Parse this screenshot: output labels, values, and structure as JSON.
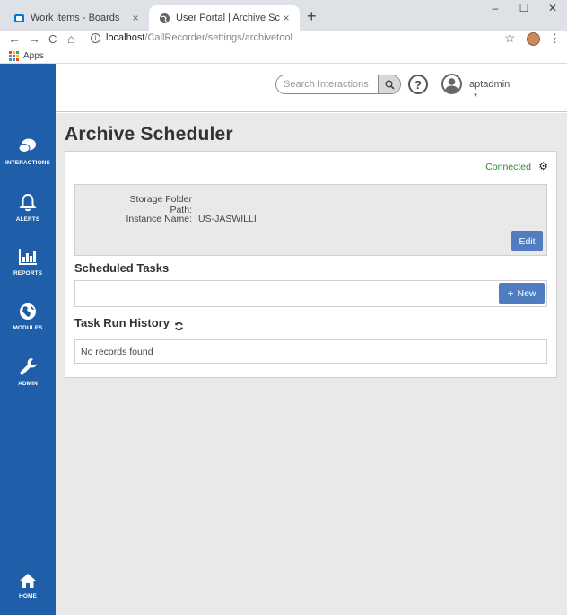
{
  "browser": {
    "tabs": [
      {
        "title": "Work items - Boards",
        "close": "×"
      },
      {
        "title": "User Portal | Archive Scheduler",
        "close": "×"
      }
    ],
    "new_tab": "+",
    "window_controls": {
      "minimize": "–",
      "maximize": "☐",
      "close": "✕"
    },
    "nav": {
      "back": "←",
      "forward": "→",
      "reload": "C",
      "home": "⌂"
    },
    "url_host": "localhost",
    "url_path": "/CallRecorder/settings/archivetool",
    "star": "☆",
    "menu": "⋮",
    "bookmarks_apps": "Apps",
    "apps_colors": [
      "#ea4335",
      "#fbbc04",
      "#34a853",
      "#4285f4",
      "#ea4335",
      "#fbbc04",
      "#34a853",
      "#4285f4",
      "#ea4335"
    ]
  },
  "sidebar": {
    "items": [
      {
        "label": "INTERACTIONS",
        "icon": "chat-bubbles-icon"
      },
      {
        "label": "ALERTS",
        "icon": "bell-icon"
      },
      {
        "label": "REPORTS",
        "icon": "bar-chart-icon"
      },
      {
        "label": "MODULES",
        "icon": "globe-icon"
      },
      {
        "label": "ADMIN",
        "icon": "wrench-icon"
      }
    ],
    "home": {
      "label": "HOME",
      "icon": "house-icon"
    },
    "bg_color": "#1f5ea9"
  },
  "header": {
    "search_placeholder": "Search Interactions",
    "help": "?",
    "username": "aptadmin",
    "caret": "▼"
  },
  "page": {
    "title": "Archive Scheduler",
    "status": "Connected",
    "status_color": "#2e8b2e",
    "storage_folder_label": "Storage Folder Path:",
    "storage_folder_value": "",
    "instance_label": "Instance Name:",
    "instance_value": "US-JASWILLI",
    "edit_label": "Edit",
    "scheduled_tasks_title": "Scheduled Tasks",
    "new_label": "New",
    "new_plus": "+",
    "task_history_title": "Task Run History",
    "no_records": "No records found",
    "accent_color": "#4f7dc0"
  }
}
